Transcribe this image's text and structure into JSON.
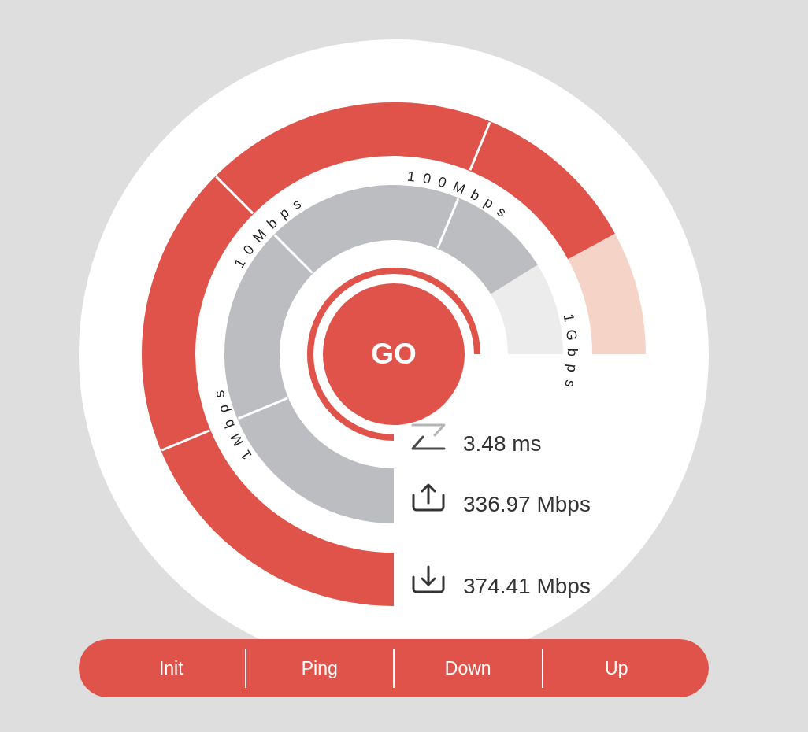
{
  "gauge": {
    "outer_ring": {
      "level": 0.894
    },
    "scale_labels": [
      "1Mbps",
      "10Mbps",
      "100Mbps",
      "1Gbps"
    ],
    "inner_ring": {
      "level": 0.882
    },
    "ping_ring": {
      "level": 1
    },
    "start_button": "GO"
  },
  "results": [
    {
      "kind": "ping",
      "value": "3.48 ms"
    },
    {
      "kind": "upload",
      "value": "336.97 Mbps"
    },
    {
      "kind": "download",
      "value": "374.41 Mbps"
    }
  ],
  "steps": [
    "Init",
    "Ping",
    "Down",
    "Up"
  ]
}
